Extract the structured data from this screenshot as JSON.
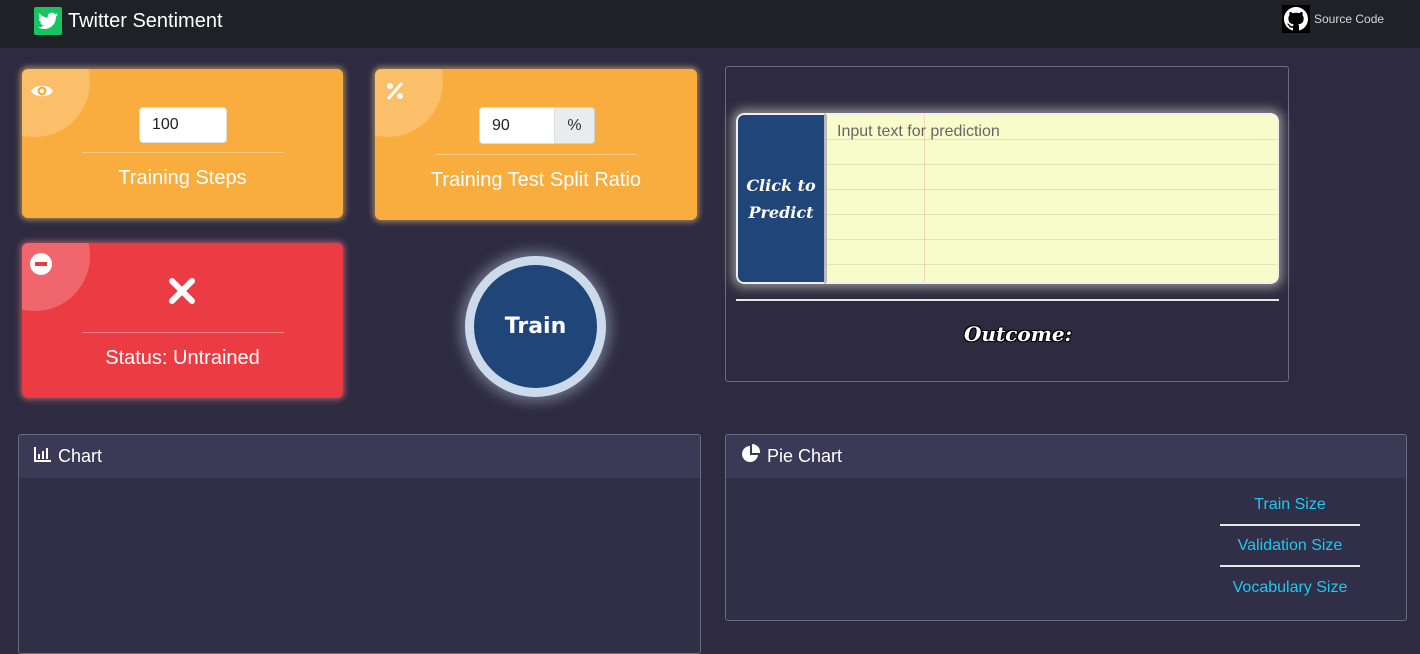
{
  "navbar": {
    "brand_title": "Twitter Sentiment",
    "source_label": "Source Code"
  },
  "training_steps": {
    "value": "100",
    "label": "Training Steps"
  },
  "split_ratio": {
    "value": "90",
    "addon": "%",
    "label": "Training Test Split Ratio"
  },
  "status": {
    "label": "Status: Untrained"
  },
  "train_button": {
    "label": "Train"
  },
  "predict": {
    "button_label": "Click to Predict",
    "placeholder": "Input text for prediction",
    "outcome_label": "Outcome:"
  },
  "chart_panel": {
    "title": "Chart"
  },
  "pie_panel": {
    "title": "Pie Chart",
    "legend": [
      "Train Size",
      "Validation Size",
      "Vocabulary Size"
    ]
  },
  "colors": {
    "background": "#2e2b41",
    "navbar": "#1f2127",
    "card_orange": "#f9ad3e",
    "card_red": "#ec3c43",
    "primary_blue": "#1f4579",
    "legend_cyan": "#1ec8f0",
    "brand_green": "#17c45f"
  },
  "icons": {
    "brand": "twitter-bird-icon",
    "source": "github-icon",
    "steps": "eye-icon",
    "split": "percent-icon",
    "status_corner": "minus-circle-icon",
    "status_main": "x-mark-icon",
    "chart": "bar-chart-icon",
    "pie": "pie-chart-icon"
  }
}
